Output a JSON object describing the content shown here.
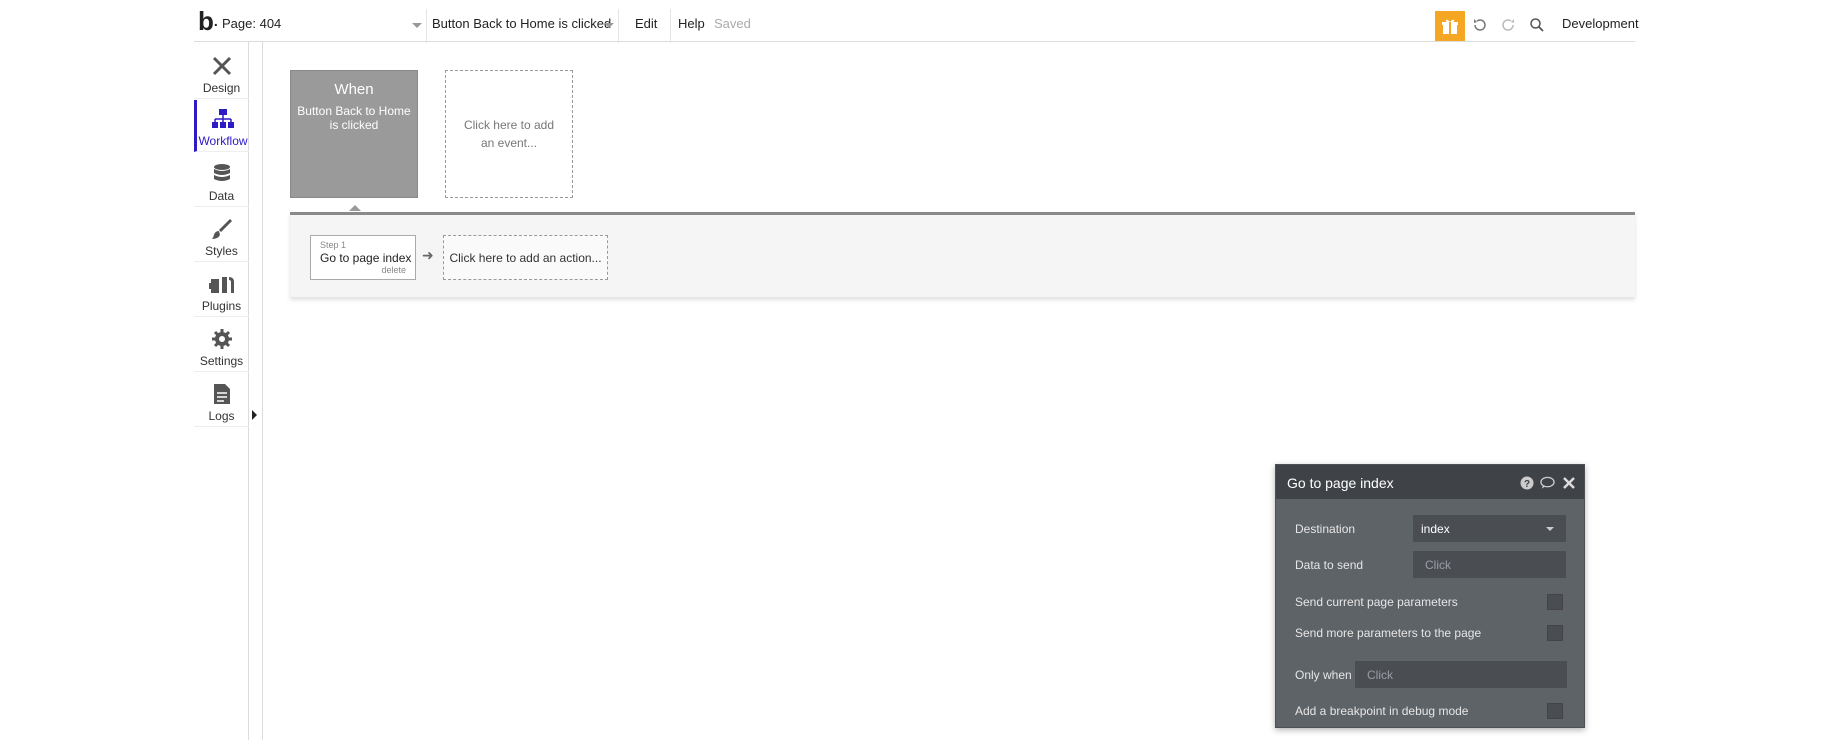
{
  "topbar": {
    "logo": "b",
    "page_selector": "Page: 404",
    "event_selector": "Button Back to Home is clicked",
    "menu_edit": "Edit",
    "menu_help": "Help",
    "save_status": "Saved",
    "environment": "Development",
    "accent_color": "#f5a623"
  },
  "sidebar": {
    "items": [
      {
        "label": "Design",
        "icon": "design-tools-icon"
      },
      {
        "label": "Workflow",
        "icon": "workflow-icon"
      },
      {
        "label": "Data",
        "icon": "database-icon"
      },
      {
        "label": "Styles",
        "icon": "brush-icon"
      },
      {
        "label": "Plugins",
        "icon": "plug-icon"
      },
      {
        "label": "Settings",
        "icon": "gear-icon"
      },
      {
        "label": "Logs",
        "icon": "document-icon"
      }
    ],
    "active": "Workflow",
    "active_color": "#2d1bc4"
  },
  "canvas": {
    "event": {
      "heading": "When",
      "description": "Button Back to Home is clicked"
    },
    "add_event_label": "Click here to add an event...",
    "steps": [
      {
        "number": "Step 1",
        "title": "Go to page index",
        "delete_label": "delete"
      }
    ],
    "add_action_label": "Click here to add an action..."
  },
  "panel": {
    "title": "Go to page index",
    "destination_label": "Destination",
    "destination_value": "index",
    "data_to_send_label": "Data to send",
    "data_to_send_placeholder": "Click",
    "send_current_params_label": "Send current page parameters",
    "send_more_params_label": "Send more parameters to the page",
    "only_when_label": "Only when",
    "only_when_placeholder": "Click",
    "breakpoint_label": "Add a breakpoint in debug mode",
    "bg_color": "#5e6368"
  }
}
